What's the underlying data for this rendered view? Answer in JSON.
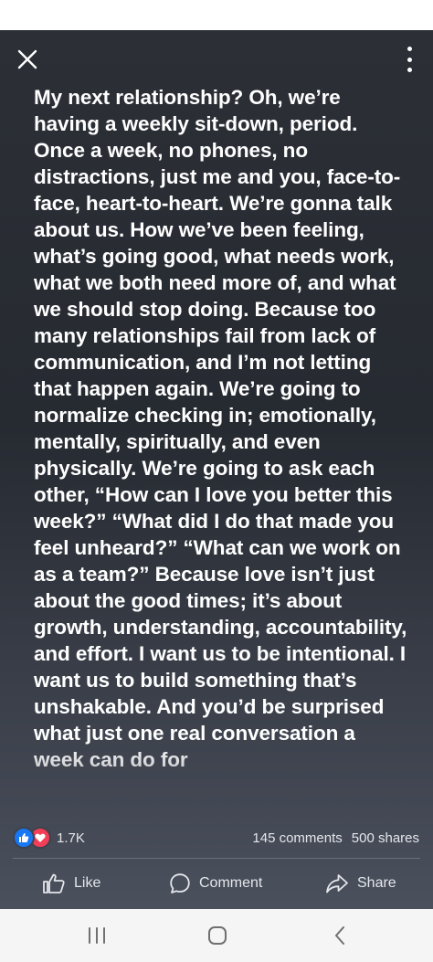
{
  "post": {
    "text": "My next relationship? Oh, we’re having a weekly sit-down, period. Once a week, no phones, no distractions, just me and you, face-to-face, heart-to-heart. We’re gonna talk about us. How we’ve been feeling, what’s going good, what needs work, what we both need more of, and what we should stop doing. Because too many relationships fail from lack of communication, and I’m not letting that happen again. We’re going to normalize checking in; emotionally, mentally, spiritually, and even physically. We’re going to ask each other, “How can I love you better this week?” “What did I do that made you feel unheard?” “What can we work on as a team?” Because love isn’t just about the good times; it’s about growth, understanding, accountability, and effort. I want us to be intentional. I want us to build something that’s unshakable. And you’d be surprised what just one real conversation a week can do for"
  },
  "reactions": {
    "icons": [
      "like-icon",
      "love-icon"
    ],
    "count": "1.7K"
  },
  "stats": {
    "comments": "145 comments",
    "shares": "500 shares"
  },
  "actions": {
    "like": "Like",
    "comment": "Comment",
    "share": "Share"
  },
  "colors": {
    "like_blue": "#1877f2",
    "love_red": "#f33e58",
    "background": "#2c2f36"
  }
}
